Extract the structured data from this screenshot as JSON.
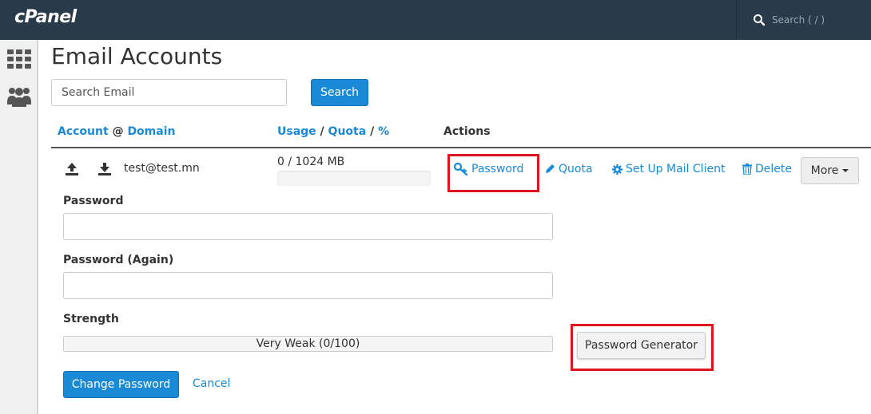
{
  "topbar": {
    "logo": "cPanel",
    "search_placeholder": "Search ( / )",
    "search_icon": "search-icon"
  },
  "sidebar": {
    "items": [
      {
        "icon": "grid-icon"
      },
      {
        "icon": "users-icon"
      }
    ]
  },
  "page": {
    "title": "Email Accounts"
  },
  "email_search": {
    "placeholder": "Search Email",
    "button": "Search"
  },
  "table": {
    "headers": {
      "account": "Account",
      "at": "@",
      "domain": "Domain",
      "usage": "Usage",
      "slash1": "/",
      "quota": "Quota",
      "slash2": "/",
      "percent": "%",
      "actions": "Actions"
    },
    "row": {
      "account": "test@test.mn",
      "usage": "0 / 1024 MB",
      "usage_fraction": 0.0,
      "icons": [
        "upload-icon",
        "download-icon"
      ]
    },
    "actions": {
      "password": "Password",
      "quota": "Quota",
      "mail_client": "Set Up Mail Client",
      "delete": "Delete",
      "more": "More"
    }
  },
  "form": {
    "password_label": "Password",
    "password_again_label": "Password (Again)",
    "strength_label": "Strength",
    "strength_text": "Very Weak (0/100)",
    "strength_value": 0,
    "generator_button": "Password Generator",
    "submit_button": "Change Password",
    "cancel_link": "Cancel"
  },
  "colors": {
    "topbar": "#293a4a",
    "link": "#1a8ad7",
    "highlight": "#e0141e"
  }
}
